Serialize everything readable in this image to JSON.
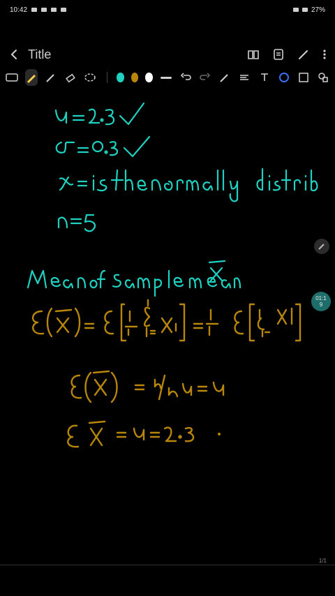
{
  "status": {
    "time": "10:42",
    "battery": "27%"
  },
  "header": {
    "title": "Title"
  },
  "toolbar": {
    "colors": [
      "#1fd1c0",
      "#b8860b",
      "#ffffff"
    ]
  },
  "side": {
    "timer": "01:1\n9",
    "page": "1/1"
  }
}
